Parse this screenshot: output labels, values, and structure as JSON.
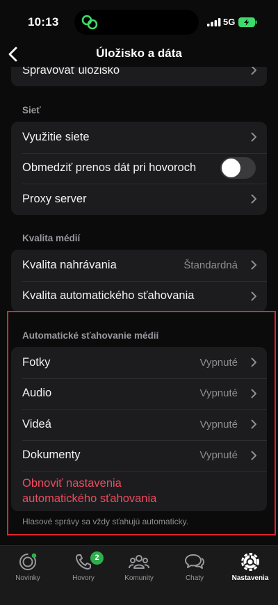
{
  "status_bar": {
    "time": "10:13",
    "network": "5G"
  },
  "nav": {
    "title": "Úložisko a dáta"
  },
  "storage": {
    "manage_label": "Spravovať úložisko"
  },
  "network": {
    "header": "Sieť",
    "usage_label": "Využitie siete",
    "limit_calls_label": "Obmedziť prenos dát pri hovoroch",
    "limit_calls_on": false,
    "proxy_label": "Proxy server"
  },
  "media_quality": {
    "header": "Kvalita médií",
    "upload_label": "Kvalita nahrávania",
    "upload_value": "Štandardná",
    "autodownload_quality_label": "Kvalita automatického sťahovania"
  },
  "auto_download": {
    "header": "Automatické sťahovanie médií",
    "items": [
      {
        "label": "Fotky",
        "value": "Vypnuté"
      },
      {
        "label": "Audio",
        "value": "Vypnuté"
      },
      {
        "label": "Videá",
        "value": "Vypnuté"
      },
      {
        "label": "Dokumenty",
        "value": "Vypnuté"
      }
    ],
    "reset_label_line1": "Obnoviť nastavenia",
    "reset_label_line2": "automatického sťahovania",
    "footnote": "Hlasové správy sa vždy sťahujú automaticky."
  },
  "tab_bar": {
    "tabs": [
      {
        "label": "Novinky",
        "icon": "updates-icon"
      },
      {
        "label": "Hovory",
        "icon": "phone-icon",
        "badge": "2"
      },
      {
        "label": "Komunity",
        "icon": "communities-icon"
      },
      {
        "label": "Chaty",
        "icon": "chats-icon"
      },
      {
        "label": "Nastavenia",
        "icon": "settings-icon",
        "active": true
      }
    ]
  },
  "colors": {
    "background": "#0b0b0b",
    "card": "#1c1c1e",
    "destructive": "#ef4c5f",
    "badge": "#2fae4e",
    "highlight_border": "#e0262b",
    "island_icon": "#3ddc68"
  }
}
